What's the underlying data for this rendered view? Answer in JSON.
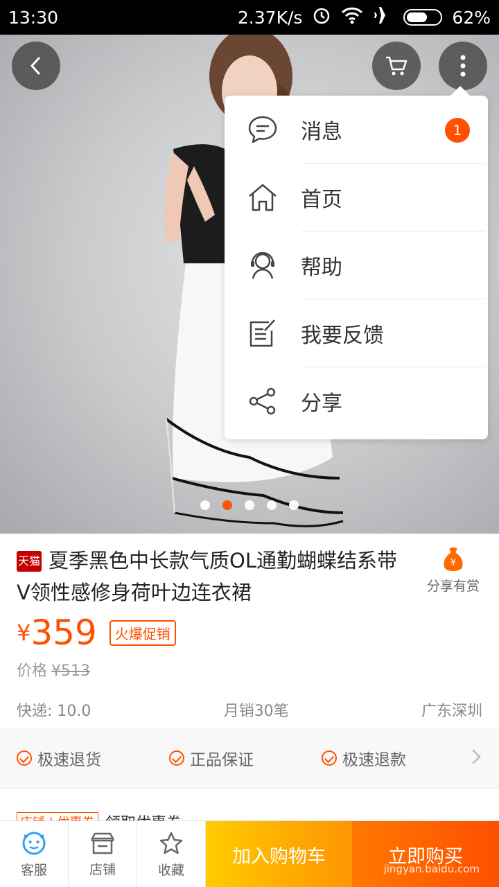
{
  "status": {
    "time": "13:30",
    "speed": "2.37K/s",
    "battery": "62%"
  },
  "nav": {
    "back_icon": "back-icon",
    "cart_icon": "cart-icon",
    "more_icon": "more-icon"
  },
  "menu": {
    "items": [
      {
        "label": "消息",
        "icon": "message-icon",
        "badge": "1"
      },
      {
        "label": "首页",
        "icon": "home-icon"
      },
      {
        "label": "帮助",
        "icon": "help-icon"
      },
      {
        "label": "我要反馈",
        "icon": "feedback-icon"
      },
      {
        "label": "分享",
        "icon": "share-icon"
      }
    ]
  },
  "carousel": {
    "count": 5,
    "active_index": 1
  },
  "product": {
    "platform_tag": "天猫",
    "title": "夏季黑色中长款气质OL通勤蝴蝶结系带V领性感修身荷叶边连衣裙",
    "share_reward": "分享有赏",
    "currency": "¥",
    "price": "359",
    "promo": "火爆促销",
    "orig_label": "价格",
    "orig_price": "¥513",
    "shipping": "快递: 10.0",
    "monthly_sales": "月销30笔",
    "location": "广东深圳"
  },
  "guarantees": [
    "极速退货",
    "正品保证",
    "极速退款"
  ],
  "coupon": {
    "tag": "店铺 | 优惠券",
    "text": "领取优惠券"
  },
  "bottombar": {
    "service": "客服",
    "shop": "店铺",
    "favorite": "收藏",
    "add_cart": "加入购物车",
    "buy_now": "立即购买",
    "watermark": "jingyan.baidu.com"
  },
  "colors": {
    "accent": "#ff5000",
    "cart_btn": "#ffb000",
    "buy_btn": "#ff5a00"
  }
}
